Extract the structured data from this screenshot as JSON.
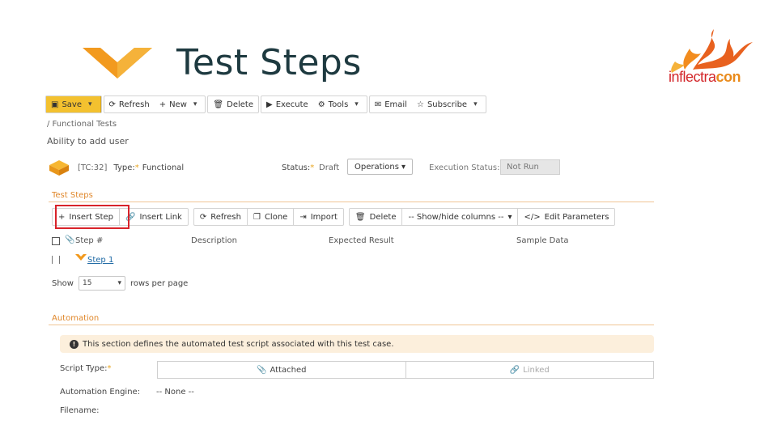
{
  "slide": {
    "title": "Test Steps",
    "brand": {
      "part1": "inflectra",
      "part2": "con"
    }
  },
  "toolbar": {
    "save": "Save",
    "refresh": "Refresh",
    "new": "New",
    "delete": "Delete",
    "execute": "Execute",
    "tools": "Tools",
    "email": "Email",
    "subscribe": "Subscribe"
  },
  "breadcrumb": "/ Functional Tests",
  "page_name": "Ability to add user",
  "test_case": {
    "id": "[TC:32]",
    "type_label": "Type:",
    "type_value": "Functional",
    "status_label": "Status:",
    "status_value": "Draft",
    "operations": "Operations",
    "exec_status_label": "Execution Status:",
    "exec_status_value": "Not Run"
  },
  "test_steps": {
    "section_title": "Test Steps",
    "buttons": {
      "insert_step": "Insert Step",
      "insert_link": "Insert Link",
      "refresh": "Refresh",
      "clone": "Clone",
      "import": "Import",
      "delete": "Delete",
      "show_hide": "-- Show/hide columns --",
      "edit_params": "Edit Parameters"
    },
    "columns": [
      "Step #",
      "Description",
      "Expected Result",
      "Sample Data"
    ],
    "rows": [
      {
        "step": "Step 1"
      }
    ],
    "pager": {
      "show": "Show",
      "value": "15",
      "suffix": "rows per page"
    }
  },
  "automation": {
    "section_title": "Automation",
    "notice": "This section defines the automated test script associated with this test case.",
    "script_type_label": "Script Type:",
    "script_type_options": [
      "Attached",
      "Linked"
    ],
    "engine_label": "Automation Engine:",
    "engine_value": "-- None --",
    "filename_label": "Filename:"
  },
  "colors": {
    "accent_orange": "#e0872a",
    "save_yellow": "#f3c12f",
    "highlight_red": "#d8232a",
    "link_blue": "#1f6aa5",
    "title_dark": "#1e3a40"
  }
}
